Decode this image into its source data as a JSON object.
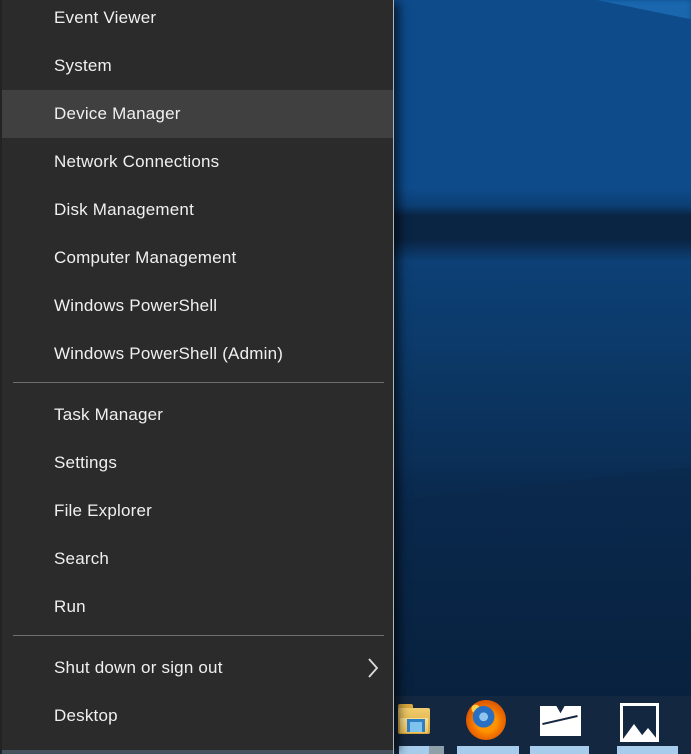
{
  "menu": {
    "items": [
      {
        "label": "Event Viewer"
      },
      {
        "label": "System"
      },
      {
        "label": "Device Manager",
        "highlighted": true
      },
      {
        "label": "Network Connections"
      },
      {
        "label": "Disk Management"
      },
      {
        "label": "Computer Management"
      },
      {
        "label": "Windows PowerShell"
      },
      {
        "label": "Windows PowerShell (Admin)"
      },
      {
        "type": "separator"
      },
      {
        "label": "Task Manager"
      },
      {
        "label": "Settings"
      },
      {
        "label": "File Explorer"
      },
      {
        "label": "Search"
      },
      {
        "label": "Run"
      },
      {
        "type": "separator"
      },
      {
        "label": "Shut down or sign out",
        "submenu": true
      },
      {
        "label": "Desktop"
      }
    ]
  },
  "taskbar": {
    "icons": [
      {
        "name": "file-explorer",
        "title": "File Explorer"
      },
      {
        "name": "firefox",
        "title": "Firefox"
      },
      {
        "name": "mail",
        "title": "Mail"
      },
      {
        "name": "photos",
        "title": "Photos"
      }
    ]
  },
  "colors": {
    "menu_background": "#2b2b2b",
    "menu_highlight": "#404040",
    "menu_text": "#f0f0f0",
    "separator": "#6e6e6e",
    "wallpaper_blue": "#0e4b8b",
    "wallpaper_dark_band": "#0a2444",
    "taskbar_background": "#142740",
    "indicator_bar_blue": "#a8cdec"
  }
}
